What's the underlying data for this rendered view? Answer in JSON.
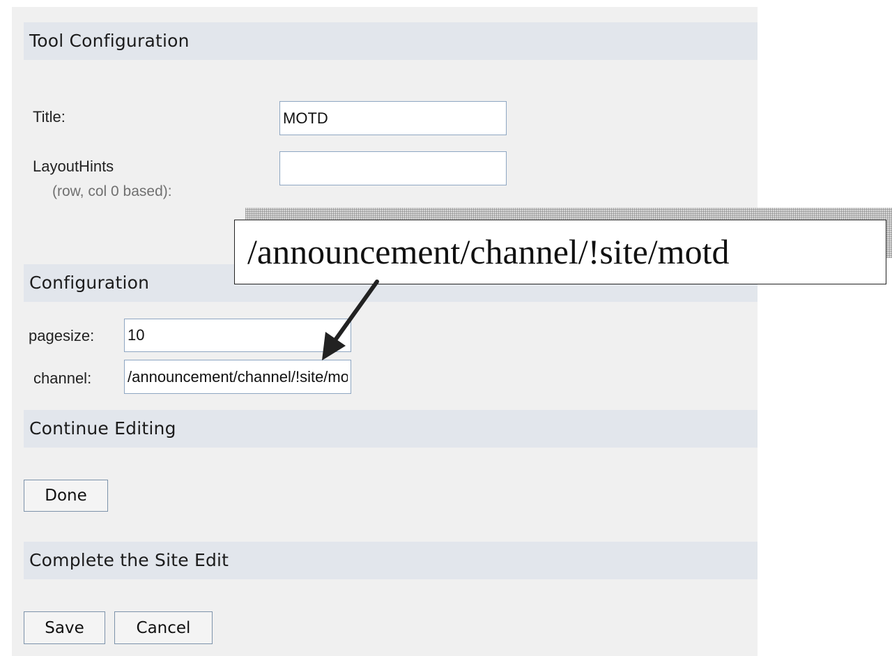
{
  "sections": {
    "tool_configuration": "Tool Configuration",
    "configuration": "Configuration",
    "continue_editing": "Continue Editing",
    "complete_site_edit": "Complete the Site Edit"
  },
  "tool": {
    "title_label": "Title:",
    "title_value": "MOTD",
    "layout_label": "LayoutHints",
    "layout_sublabel": "(row, col 0 based):",
    "layout_value": ""
  },
  "config": {
    "pagesize_label": "pagesize:",
    "pagesize_value": "10",
    "channel_label": "channel:",
    "channel_value": "/announcement/channel/!site/motd"
  },
  "buttons": {
    "done": "Done",
    "save": "Save",
    "cancel": "Cancel"
  },
  "callout": {
    "text": "/announcement/channel/!site/motd"
  },
  "colors": {
    "panel_bg": "#f0f0f0",
    "header_bg": "#e2e6ec",
    "input_border": "#8ea6c2"
  }
}
